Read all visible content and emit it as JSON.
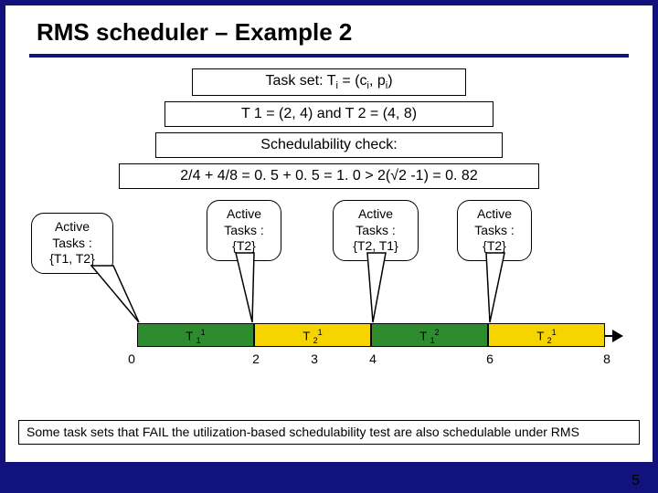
{
  "title": "RMS scheduler – Example 2",
  "box_taskset_html": "Task set: T<span class='sub'>i</span> = (c<span class='sub'>i</span>, p<span class='sub'>i</span>)",
  "box_tasks": "T 1 = (2, 4) and T 2 = (4, 8)",
  "box_check": "Schedulability check:",
  "box_eq": "2/4  +  4/8 = 0. 5 + 0. 5 = 1. 0 > 2(√2 -1) = 0. 82",
  "bubbles": [
    {
      "l1": "Active",
      "l2": "Tasks :",
      "l3": "{T1, T2}"
    },
    {
      "l1": "Active",
      "l2": "Tasks :",
      "l3": "{T2}"
    },
    {
      "l1": "Active",
      "l2": "Tasks :",
      "l3": "{T2, T1}"
    },
    {
      "l1": "Active",
      "l2": "Tasks :",
      "l3": "{T2}"
    }
  ],
  "segments": [
    {
      "label_html": "T <span class='sub'>1</span><span class='sup'>1</span>"
    },
    {
      "label_html": "T <span class='sub'>2</span><span class='sup'>1</span>"
    },
    {
      "label_html": "T <span class='sub'>1</span><span class='sup'>2</span>"
    },
    {
      "label_html": "T <span class='sub'>2</span><span class='sup'>1</span>"
    }
  ],
  "ticks": [
    "0",
    "2",
    "3",
    "4",
    "6",
    "8"
  ],
  "note": "Some task sets that FAIL the utilization-based schedulability test are also schedulable under RMS",
  "pagenum": "5",
  "chart_data": {
    "type": "bar",
    "description": "RMS schedule timeline from t=0 to t=8",
    "segments": [
      {
        "task": "T1",
        "instance": 1,
        "start": 0,
        "end": 2,
        "color": "green"
      },
      {
        "task": "T2",
        "instance": 1,
        "start": 2,
        "end": 4,
        "color": "yellow"
      },
      {
        "task": "T1",
        "instance": 2,
        "start": 4,
        "end": 6,
        "color": "green"
      },
      {
        "task": "T2",
        "instance": 1,
        "start": 6,
        "end": 8,
        "color": "yellow"
      }
    ],
    "tick_values": [
      0,
      2,
      3,
      4,
      6,
      8
    ],
    "active_tasks_at": [
      {
        "t": 0,
        "set": [
          "T1",
          "T2"
        ]
      },
      {
        "t": 2,
        "set": [
          "T2"
        ]
      },
      {
        "t": 4,
        "set": [
          "T2",
          "T1"
        ]
      },
      {
        "t": 6,
        "set": [
          "T2"
        ]
      }
    ]
  }
}
